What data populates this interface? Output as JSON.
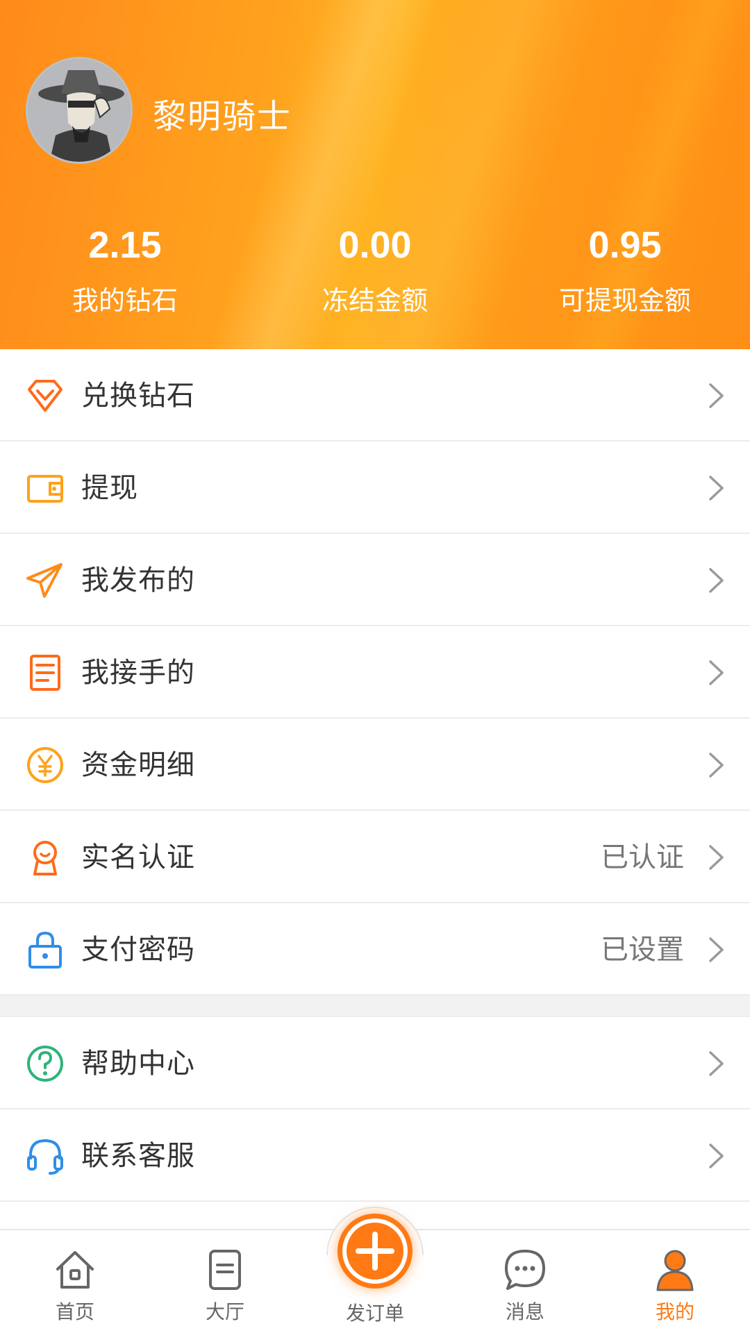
{
  "profile": {
    "username": "黎明骑士"
  },
  "stats": [
    {
      "value": "2.15",
      "label": "我的钻石"
    },
    {
      "value": "0.00",
      "label": "冻结金额"
    },
    {
      "value": "0.95",
      "label": "可提现金额"
    }
  ],
  "menu": [
    {
      "label": "兑换钻石",
      "icon": "diamond-icon",
      "status": ""
    },
    {
      "label": "提现",
      "icon": "wallet-icon",
      "status": ""
    },
    {
      "label": "我发布的",
      "icon": "paper-plane-icon",
      "status": ""
    },
    {
      "label": "我接手的",
      "icon": "document-icon",
      "status": ""
    },
    {
      "label": "资金明细",
      "icon": "yuan-coin-icon",
      "status": ""
    },
    {
      "label": "实名认证",
      "icon": "id-badge-icon",
      "status": "已认证"
    },
    {
      "label": "支付密码",
      "icon": "lock-icon",
      "status": "已设置"
    }
  ],
  "menu_support": [
    {
      "label": "帮助中心",
      "icon": "question-icon",
      "status": ""
    },
    {
      "label": "联系客服",
      "icon": "headset-icon",
      "status": ""
    }
  ],
  "tabbar": {
    "items": [
      {
        "label": "首页",
        "icon": "home-icon"
      },
      {
        "label": "大厅",
        "icon": "hall-icon"
      },
      {
        "label": "发订单",
        "icon": "plus-icon"
      },
      {
        "label": "消息",
        "icon": "message-icon"
      },
      {
        "label": "我的",
        "icon": "profile-icon",
        "active": true
      }
    ]
  },
  "colors": {
    "accent": "#ff7a14",
    "header_gradient_start": "#ff8a1a",
    "header_gradient_mid": "#ffb323",
    "help_icon": "#2fb37a",
    "support_icon": "#2f8ee8",
    "lock_icon": "#2f8ee8"
  }
}
